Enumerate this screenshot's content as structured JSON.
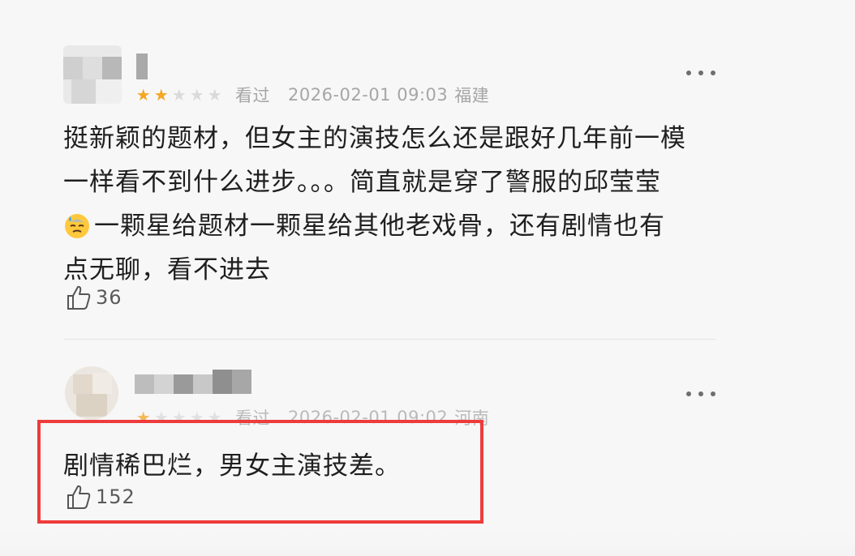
{
  "comments": [
    {
      "stars_filled": 2,
      "stars_total": 5,
      "watched_label": "看过",
      "time": "2026-02-01 09:03",
      "location": "福建",
      "text_lines": [
        "挺新颖的题材，但女主的演技怎么还是跟好几年前一模",
        "一样看不到什么进步。。。简直就是穿了警服的邱莹莹",
        "一颗星给题材一颗星给其他老戏骨，还有剧情也有",
        "点无聊，看不进去"
      ],
      "emoji_name": "sweat-smile-emoji",
      "likes": "36"
    },
    {
      "stars_filled": 1,
      "stars_total": 5,
      "watched_label": "看过",
      "time": "2026-02-01 09:02",
      "location": "河南",
      "text": "剧情稀巴烂，男女主演技差。",
      "likes": "152"
    }
  ],
  "colors": {
    "star_on": "#f5a623",
    "star_off": "#dadada",
    "highlight_border": "#ee3b3b",
    "meta_text": "#a6a6a6"
  },
  "icons": {
    "like": "thumbs-up-icon",
    "more": "more-dots-icon"
  }
}
